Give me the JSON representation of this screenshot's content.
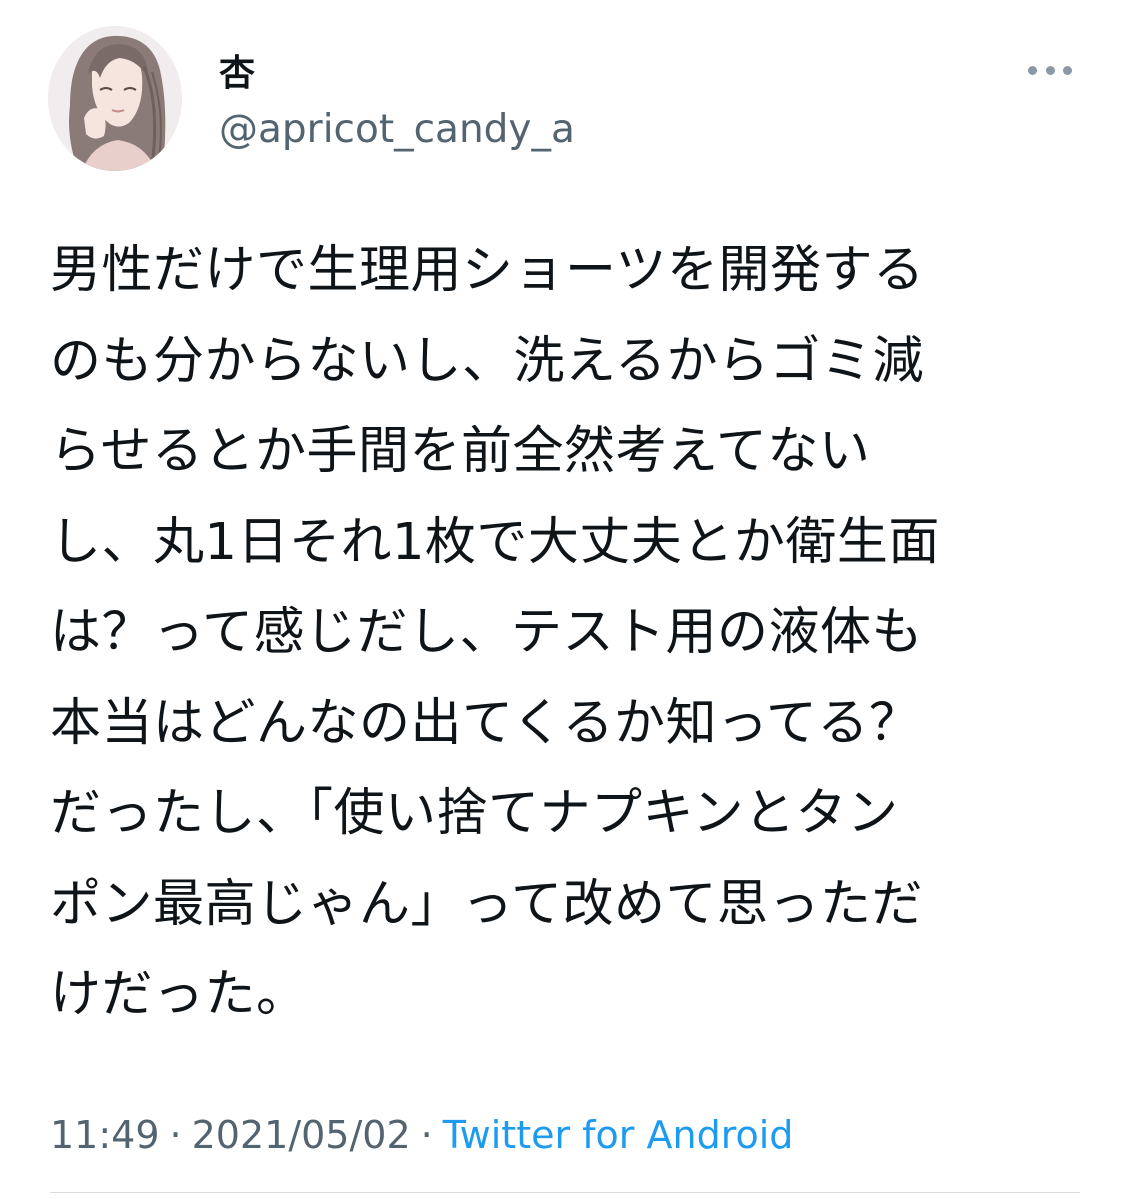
{
  "tweet": {
    "display_name": "杏",
    "handle": "@apricot_candy_a",
    "text": "男性だけで生理用ショーツを開発する\nのも分からないし、洗えるからゴミ減\nらせるとか手間を前全然考えてない\nし、丸1日それ1枚で大丈夫とか衛生面\nは？って感じだし、テスト用の液体も\n本当はどんなの出てくるか知ってる？\nだったし、「使い捨てナプキンとタン\nポン最高じゃん」って改めて思っただ\nけだった。",
    "time": "11:49",
    "date": "2021/05/02",
    "separator": "·",
    "source": "Twitter for Android"
  },
  "icons": {
    "avatar": "user-avatar-illustration",
    "more": "more-horizontal-icon"
  },
  "colors": {
    "text_primary": "#0f1419",
    "text_secondary": "#536471",
    "link": "#1d9bf0"
  }
}
